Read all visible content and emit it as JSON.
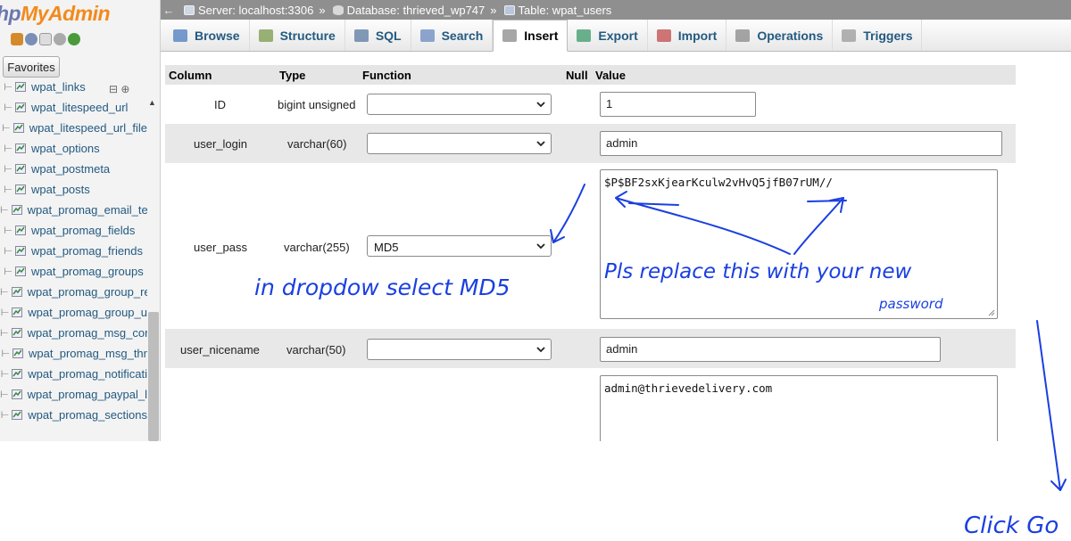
{
  "sidebar": {
    "logo_php": "hp",
    "logo_admin": "MyAdmin",
    "favorites_label": "Favorites",
    "items": [
      "wpat_links",
      "wpat_litespeed_url",
      "wpat_litespeed_url_file",
      "wpat_options",
      "wpat_postmeta",
      "wpat_posts",
      "wpat_promag_email_te",
      "wpat_promag_fields",
      "wpat_promag_friends",
      "wpat_promag_groups",
      "wpat_promag_group_re",
      "wpat_promag_group_u",
      "wpat_promag_msg_cor",
      "wpat_promag_msg_thr",
      "wpat_promag_notificati",
      "wpat_promag_paypal_l",
      "wpat_promag_sections"
    ]
  },
  "breadcrumb": {
    "server": "Server: localhost:3306",
    "database": "Database: thrieved_wp747",
    "table": "Table: wpat_users",
    "sep": "»"
  },
  "tabs": [
    "Browse",
    "Structure",
    "SQL",
    "Search",
    "Insert",
    "Export",
    "Import",
    "Operations",
    "Triggers"
  ],
  "active_tab": "Insert",
  "table": {
    "headers": {
      "column": "Column",
      "type": "Type",
      "function": "Function",
      "null": "Null",
      "value": "Value"
    },
    "rows": [
      {
        "column": "ID",
        "type": "bigint unsigned",
        "function": "",
        "value": "1"
      },
      {
        "column": "user_login",
        "type": "varchar(60)",
        "function": "",
        "value": "admin"
      },
      {
        "column": "user_pass",
        "type": "varchar(255)",
        "function": "MD5",
        "value": "$P$BF2sxKjearKculw2vHvQ5jfB07rUM//"
      },
      {
        "column": "user_nicename",
        "type": "varchar(50)",
        "function": "",
        "value": "admin"
      },
      {
        "column": "",
        "type": "",
        "function": "",
        "value": "admin@thrievedelivery.com"
      }
    ]
  },
  "annotations": {
    "dropdown_note": "in dropdow select MD5",
    "replace_note": "Pls replace this with your new",
    "replace_note_2": "password",
    "click_go": "Click Go"
  },
  "colors": {
    "accent_link": "#235a81",
    "annotation": "#1a3fe0",
    "topbar": "#8f8f8f"
  }
}
